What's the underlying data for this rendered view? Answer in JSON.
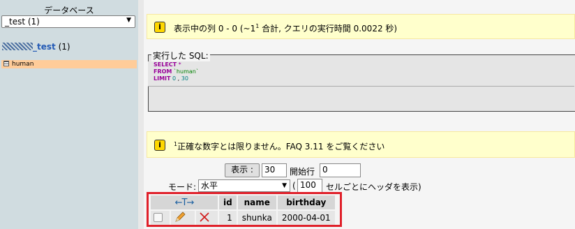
{
  "sidebar": {
    "db_label": "データベース",
    "db_select_value": "_test (1)",
    "db_link_name": "_test",
    "db_link_count": "(1)",
    "table_item": "human"
  },
  "notice1": {
    "text_before": "表示中の列 0 - 0 (",
    "text_marker": "~1",
    "text_sup": "1",
    "text_after": " 合計, クエリの実行時間 0.0022 秒)"
  },
  "sql": {
    "legend": "実行した SQL:",
    "select_kw": "SELECT",
    "select_rest": " *",
    "from_kw": "FROM",
    "from_table": " `human`",
    "limit_kw": "LIMIT",
    "limit_a": " 0",
    "limit_sep": " , ",
    "limit_b": "30"
  },
  "notice2": {
    "sup": "1",
    "text": "正確な数字とは限りません。FAQ 3.11 をご覧ください"
  },
  "nav": {
    "show_button": "表示 :",
    "rows_value": "30",
    "start_label": "開始行",
    "start_value": "0",
    "mode_label": "モード:",
    "mode_value": "水平",
    "paren_open": "(",
    "repeat_value": "100",
    "repeat_label": "セルごとにヘッダを表示)"
  },
  "table": {
    "arrows": "←T→",
    "columns": [
      "id",
      "name",
      "birthday"
    ],
    "rows": [
      {
        "id": "1",
        "name": "shunka",
        "birthday": "2000-04-01"
      }
    ]
  },
  "colors": {
    "sidebar_bg": "#d0dce0",
    "notice_bg": "#ffffcc",
    "highlight": "#e0202a",
    "sql_keyword": "#990099",
    "selected_table": "#ffcc99"
  }
}
